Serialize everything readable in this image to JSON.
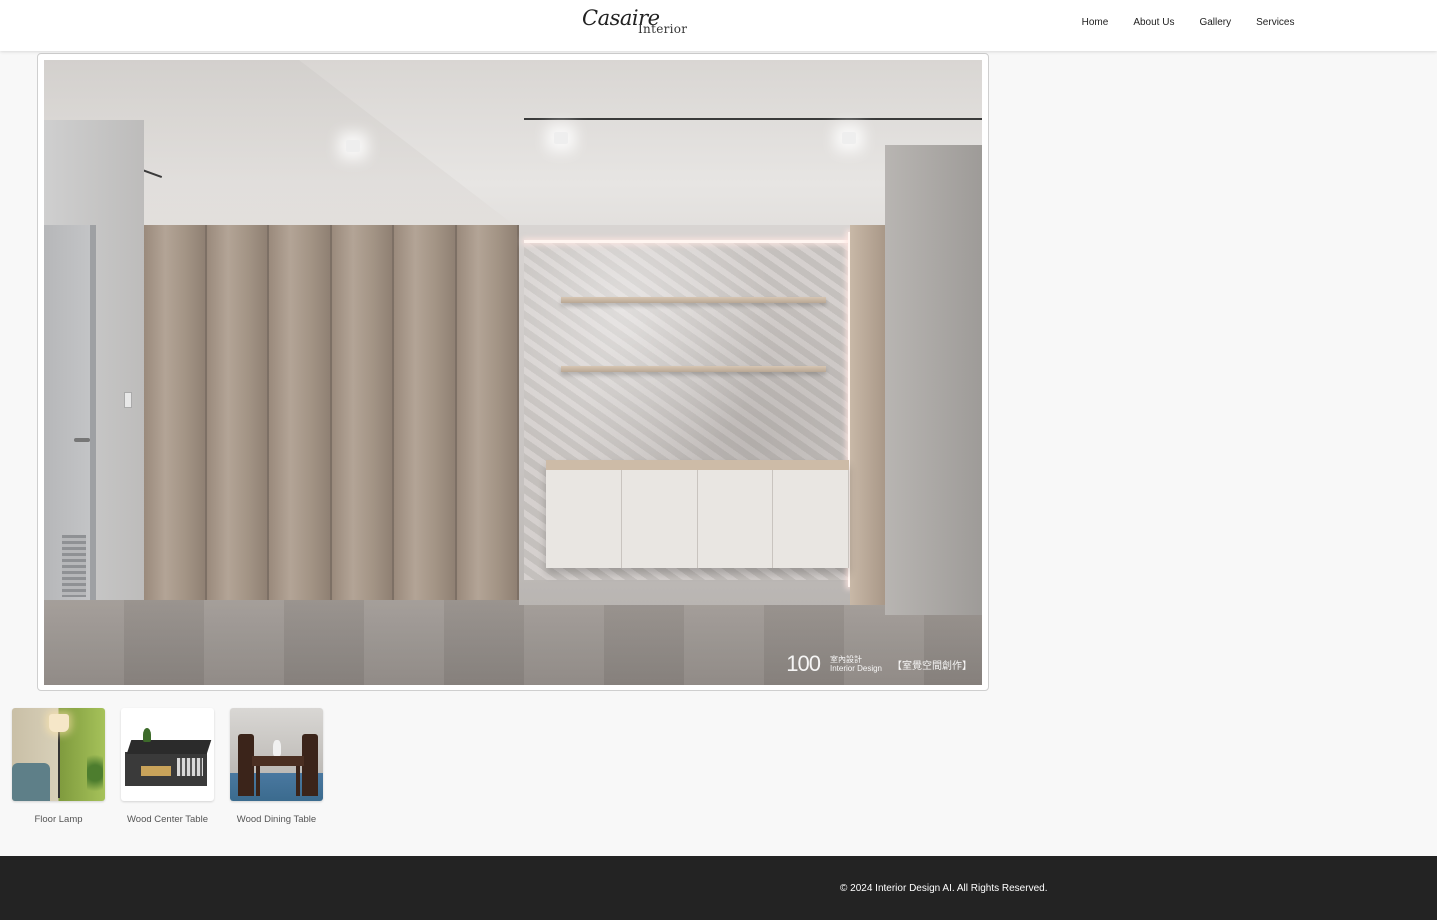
{
  "header": {
    "logo": {
      "script": "Casaire",
      "sub": "Interior"
    },
    "nav": [
      "Home",
      "About Us",
      "Gallery",
      "Services"
    ]
  },
  "hero": {
    "image_name": "interior-room-photo",
    "watermark": {
      "number": "100",
      "brand_cn": "室內設計",
      "brand_en": "Interior Design",
      "studio_cn": "【室覺空間創作】"
    }
  },
  "products": [
    {
      "label": "Floor Lamp"
    },
    {
      "label": "Wood Center Table"
    },
    {
      "label": "Wood Dining Table"
    }
  ],
  "footer": {
    "copyright": "© 2024 Interior Design AI. All Rights Reserved."
  },
  "colors": {
    "background": "#f8f8f8",
    "header": "#ffffff",
    "footer": "#232323",
    "text": "#333333"
  }
}
